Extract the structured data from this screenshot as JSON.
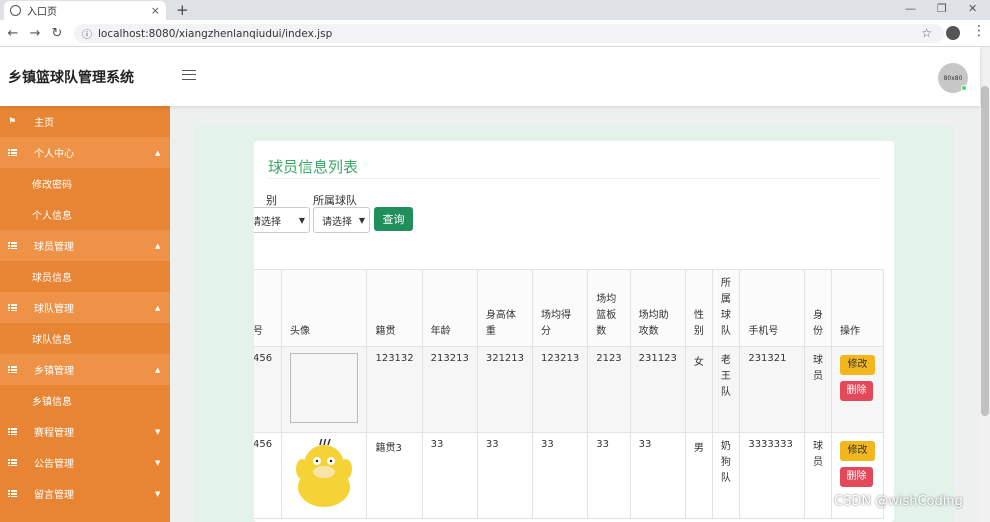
{
  "browser": {
    "tab_title": "入口页",
    "tab_close": "×",
    "new_tab": "+",
    "url": "localhost:8080/xiangzhenlanqiudui/index.jsp",
    "min": "—",
    "restore": "❐",
    "close": "✕"
  },
  "header": {
    "app_title": "乡镇篮球队管理系统",
    "avatar_text": "80x80"
  },
  "sidebar": {
    "items": [
      {
        "label": "主页"
      },
      {
        "label": "个人中心"
      },
      {
        "label": "修改密码"
      },
      {
        "label": "个人信息"
      },
      {
        "label": "球员管理"
      },
      {
        "label": "球员信息"
      },
      {
        "label": "球队管理"
      },
      {
        "label": "球队信息"
      },
      {
        "label": "乡镇管理"
      },
      {
        "label": "乡镇信息"
      },
      {
        "label": "赛程管理"
      },
      {
        "label": "公告管理"
      },
      {
        "label": "留言管理"
      }
    ]
  },
  "main": {
    "card_title": "球员信息列表",
    "filter": {
      "gender_label": "别",
      "gender_value": "请选择",
      "team_label": "所属球队",
      "team_value": "请选择",
      "query_label": "查询"
    },
    "table": {
      "headers": [
        "号",
        "头像",
        "籍贯",
        "年龄",
        "身高体重",
        "场均得分",
        "场均篮板数",
        "场均助攻数",
        "性别",
        "所属球队",
        "手机号",
        "身份",
        "操作"
      ],
      "rows": [
        {
          "c0": "456",
          "c2": "123132",
          "c3": "213213",
          "c4": "321213",
          "c5": "123213",
          "c6": "2123",
          "c7": "231123",
          "c8": "女",
          "c9": "老王队",
          "c10": "231321",
          "c11": "球员"
        },
        {
          "c0": "456",
          "c2": "籍贯3",
          "c3": "33",
          "c4": "33",
          "c5": "33",
          "c6": "33",
          "c7": "33",
          "c8": "男",
          "c9": "奶狗队",
          "c10": "3333333",
          "c11": "球员"
        }
      ],
      "edit_label": "修改",
      "delete_label": "删除"
    }
  },
  "watermark": "CSDN @wishCoding"
}
